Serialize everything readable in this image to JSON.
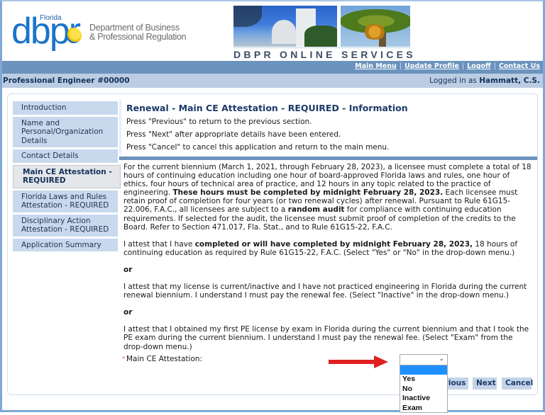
{
  "header": {
    "logo": {
      "state": "Florida",
      "wordmark": "dbpr",
      "agency_line1": "Department of Business",
      "agency_line2": "& Professional Regulation"
    },
    "banner_title": "DBPR ONLINE SERVICES"
  },
  "topnav": {
    "links": [
      "Main Menu",
      "Update Profile",
      "Logoff",
      "Contact Us"
    ],
    "separator": "|"
  },
  "subbar": {
    "license": "Professional Engineer #00000",
    "logged_in_prefix": "Logged in as ",
    "user": "Hammatt, C.S."
  },
  "sidebar": {
    "items": [
      {
        "label": "Introduction",
        "active": false
      },
      {
        "label": "Name and Personal/Organization Details",
        "active": false
      },
      {
        "label": "Contact Details",
        "active": false
      },
      {
        "label": "Main CE Attestation - REQUIRED",
        "active": true
      },
      {
        "label": "Florida Laws and Rules Attestation - REQUIRED",
        "active": false
      },
      {
        "label": "Disciplinary Action Attestation - REQUIRED",
        "active": false
      },
      {
        "label": "Application Summary",
        "active": false
      }
    ]
  },
  "info": {
    "title": "Renewal - Main CE Attestation - REQUIRED - Information",
    "lines": [
      "Press \"Previous\" to return to the previous section.",
      "Press \"Next\" after appropriate details have been entered.",
      "Press \"Cancel\" to cancel this application and return to the main menu."
    ]
  },
  "body": {
    "p1_a": "For the current biennium (March 1, 2021, through February 28, 2023), a licensee must complete a total of 18 hours of continuing education including one hour of board-approved Florida laws and rules, one hour of ethics, four hours of technical area of practice, and 12 hours in any topic related to the practice of engineering. ",
    "p1_b_bold": "These hours must be completed by midnight February 28, 2023.",
    "p1_c": " Each licensee must retain proof of completion for four years (or two renewal cycles) after renewal. Pursuant to Rule 61G15-22.006, F.A.C., all licensees are subject to a ",
    "p1_d_bold": "random audit",
    "p1_e": " for compliance with continuing education requirements. If selected for the audit, the licensee must submit proof of completion of the credits to the Board. Refer to Section 471.017, Fla. Stat., and to Rule 61G15-22, F.A.C.",
    "p2_a": "I attest that I have ",
    "p2_b_bold": "completed or will have completed by midnight February 28, 2023,",
    "p2_c": " 18 hours of continuing education as required by Rule 61G15-22, F.A.C. (Select \"Yes\" or \"No\" in the drop-down menu.)",
    "or1": "or",
    "p3": "I attest that my license is current/inactive and I have not practiced engineering in Florida during the current renewal biennium. I understand I must pay the renewal fee. (Select \"Inactive\" in the drop-down menu.)",
    "or2": "or",
    "p4": "I attest that I obtained my first PE license by exam in Florida during the current biennium and that I took the PE exam during the current biennium. I understand I must pay the renewal fee. (Select \"Exam\" from the drop-down menu.)"
  },
  "field": {
    "required_marker": "*",
    "label": "Main CE Attestation:",
    "selected_value": "",
    "options": [
      "",
      "Yes",
      "No",
      "Inactive",
      "Exam"
    ],
    "highlighted_index": 0,
    "dropdown_open": true
  },
  "annotation": {
    "arrow_color": "#e02020"
  },
  "buttons": {
    "previous": "Previous",
    "previous_visible": "vious",
    "next": "Next",
    "cancel": "Cancel"
  },
  "colors": {
    "nav_bar": "#6b93bd",
    "sub_bar": "#bccde3",
    "sidebar_item": "#c8d9ee",
    "title_text": "#1c3a68",
    "highlight": "#1e90ff"
  }
}
